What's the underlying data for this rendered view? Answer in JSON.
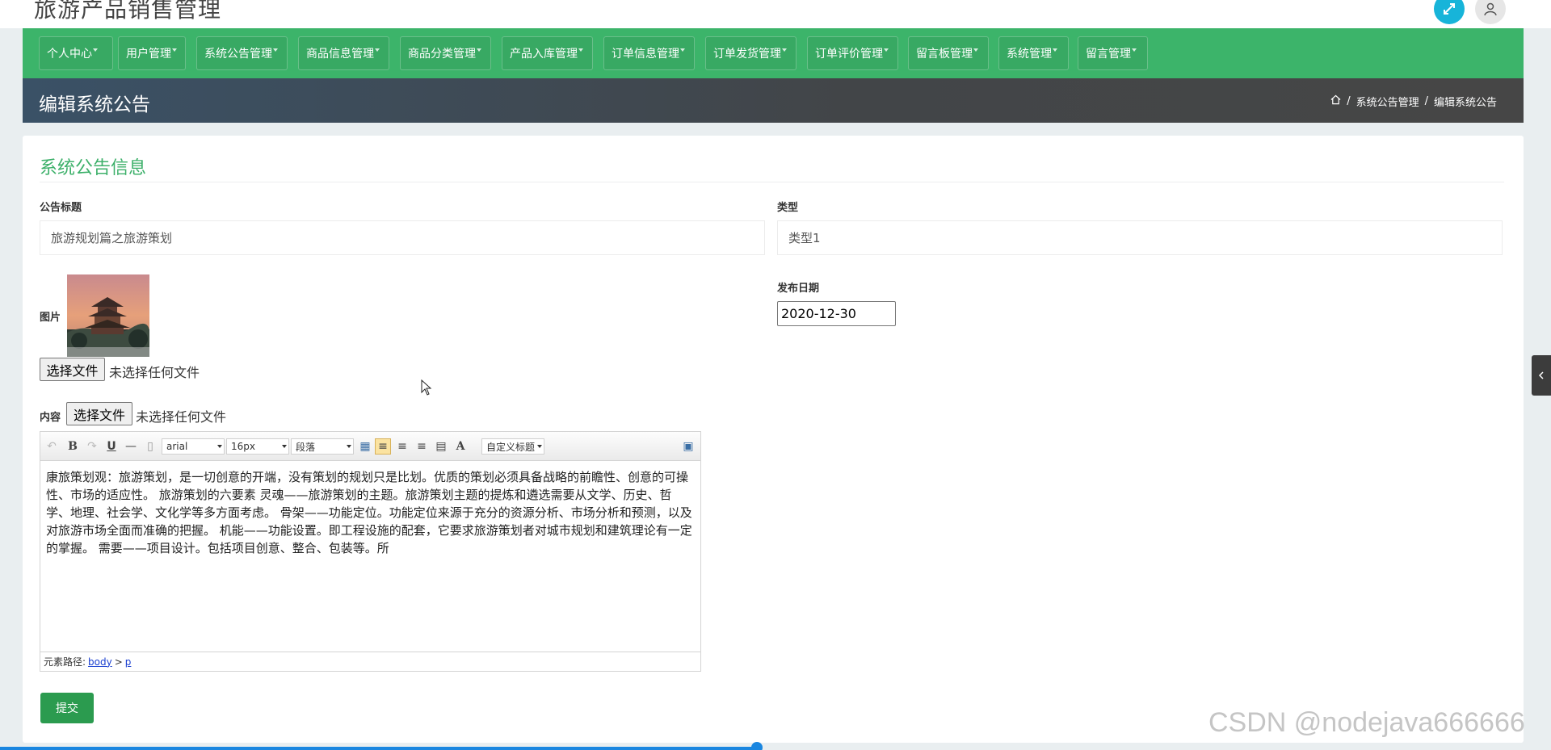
{
  "app": {
    "title": "旅游产品销售管理"
  },
  "header": {
    "expand_icon": "expand-icon",
    "user_icon": "user-icon"
  },
  "nav": {
    "items": [
      {
        "label": "个人中心",
        "dropdown": true
      },
      {
        "label": "用户管理",
        "dropdown": true
      },
      {
        "label": "系统公告管理",
        "dropdown": true
      },
      {
        "label": "商品信息管理",
        "dropdown": true
      },
      {
        "label": "商品分类管理",
        "dropdown": true
      },
      {
        "label": "产品入库管理",
        "dropdown": true
      },
      {
        "label": "订单信息管理",
        "dropdown": true
      },
      {
        "label": "订单发货管理",
        "dropdown": true
      },
      {
        "label": "订单评价管理",
        "dropdown": true
      },
      {
        "label": "留言板管理",
        "dropdown": true
      },
      {
        "label": "系统管理",
        "dropdown": true
      },
      {
        "label": "留言管理",
        "dropdown": true
      }
    ]
  },
  "page": {
    "title": "编辑系统公告",
    "breadcrumb": [
      "系统公告管理",
      "编辑系统公告"
    ]
  },
  "form": {
    "section_title": "系统公告信息",
    "title_label": "公告标题",
    "title_value": "旅游规划篇之旅游策划",
    "type_label": "类型",
    "type_value": "类型1",
    "image_label": "图片",
    "file_button": "选择文件",
    "file_none": "未选择任何文件",
    "date_label": "发布日期",
    "date_value": "2020-12-30",
    "content_label": "内容",
    "submit_label": "提交"
  },
  "editor": {
    "font_family": "arial",
    "font_size": "16px",
    "paragraph": "段落",
    "custom_title": "自定义标题",
    "content": "康旅策划观：旅游策划，是一切创意的开端，没有策划的规划只是比划。优质的策划必须具备战略的前瞻性、创意的可操性、市场的适应性。 旅游策划的六要素 灵魂——旅游策划的主题。旅游策划主题的提炼和遴选需要从文学、历史、哲学、地理、社会学、文化学等多方面考虑。 骨架——功能定位。功能定位来源于充分的资源分析、市场分析和预测，以及对旅游市场全面而准确的把握。 机能——功能设置。即工程设施的配套，它要求旅游策划者对城市规划和建筑理论有一定的掌握。 需要——项目设计。包括项目创意、整合、包装等。所",
    "path_label": "元素路径:",
    "path_body": "body",
    "path_sep": ">",
    "path_p": "p"
  },
  "watermark": "CSDN @nodejava666666",
  "colors": {
    "nav_green": "#3cb46a",
    "accent_green": "#3db06a",
    "submit_green": "#2b9b4f",
    "title_bar_dark": "#424548",
    "expand_cyan": "#17b4d9"
  }
}
